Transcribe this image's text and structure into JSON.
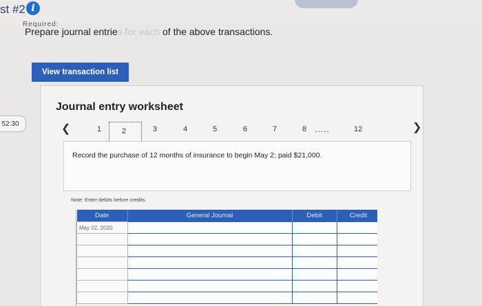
{
  "header": {
    "title": "st #2",
    "info_icon": "info-icon"
  },
  "subheading": "Required:",
  "prompt": {
    "before": "Prepare journal entrie",
    "faded": "s for each",
    "after": " of the above transactions."
  },
  "view_transactions_button": "View transaction list",
  "timer": "52:30",
  "worksheet": {
    "title": "Journal entry worksheet",
    "pages": [
      "1",
      "2",
      "3",
      "4",
      "5",
      "6",
      "7",
      "8"
    ],
    "current_page": "2",
    "ellipsis": ".....",
    "last_page": "12",
    "prev_icon": "chevron-left-icon",
    "next_icon": "chevron-right-icon",
    "description": "Record the purchase of 12 months of insurance to begin May 2; paid $21,000.",
    "note": "Note: Enter debits before credits.",
    "table": {
      "headers": {
        "date": "Date",
        "general_journal": "General Journal",
        "debit": "Debit",
        "credit": "Credit"
      },
      "first_date": "May 02, 2020"
    }
  },
  "colors": {
    "accent": "#2c5fb7",
    "info": "#1f6fd1"
  }
}
